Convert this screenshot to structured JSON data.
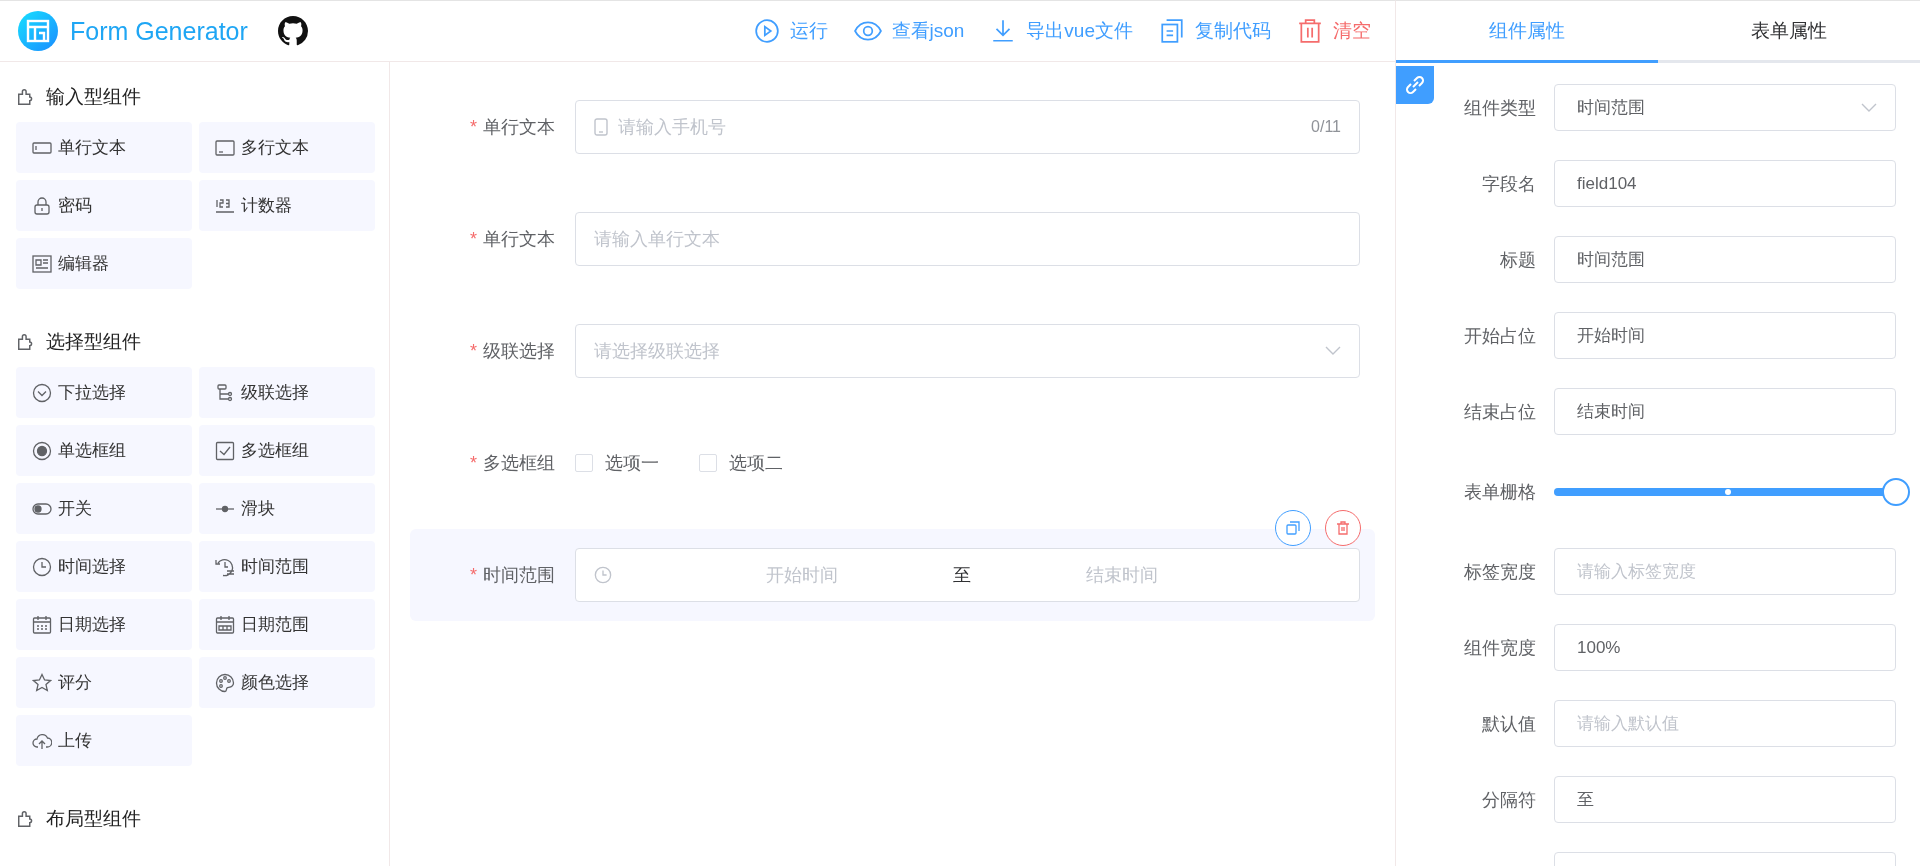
{
  "header": {
    "logo_text": "Form Generator",
    "actions": [
      {
        "label": "运行",
        "kind": "run"
      },
      {
        "label": "查看json",
        "kind": "view"
      },
      {
        "label": "导出vue文件",
        "kind": "download"
      },
      {
        "label": "复制代码",
        "kind": "copy"
      },
      {
        "label": "清空",
        "kind": "clear"
      }
    ]
  },
  "component_groups": [
    {
      "title": "输入型组件",
      "items": [
        {
          "label": "单行文本",
          "kind": "input"
        },
        {
          "label": "多行文本",
          "kind": "textarea"
        },
        {
          "label": "密码",
          "kind": "password"
        },
        {
          "label": "计数器",
          "kind": "number"
        },
        {
          "label": "编辑器",
          "kind": "editor"
        }
      ]
    },
    {
      "title": "选择型组件",
      "items": [
        {
          "label": "下拉选择",
          "kind": "select"
        },
        {
          "label": "级联选择",
          "kind": "cascader"
        },
        {
          "label": "单选框组",
          "kind": "radio"
        },
        {
          "label": "多选框组",
          "kind": "checkbox"
        },
        {
          "label": "开关",
          "kind": "switch"
        },
        {
          "label": "滑块",
          "kind": "slider"
        },
        {
          "label": "时间选择",
          "kind": "time"
        },
        {
          "label": "时间范围",
          "kind": "timerange"
        },
        {
          "label": "日期选择",
          "kind": "date"
        },
        {
          "label": "日期范围",
          "kind": "daterange"
        },
        {
          "label": "评分",
          "kind": "rate"
        },
        {
          "label": "颜色选择",
          "kind": "color"
        },
        {
          "label": "上传",
          "kind": "upload"
        }
      ]
    },
    {
      "title": "布局型组件"
    }
  ],
  "form": {
    "fields": [
      {
        "label": "单行文本",
        "required_mark": "*",
        "kind": "input",
        "prefix_icon": true,
        "placeholder": "请输入手机号",
        "counter": "0/11",
        "selected": false
      },
      {
        "label": "单行文本",
        "required_mark": "*",
        "kind": "input",
        "placeholder": "请输入单行文本",
        "selected": false
      },
      {
        "label": "级联选择",
        "required_mark": "*",
        "kind": "select",
        "placeholder": "请选择级联选择",
        "selected": false
      },
      {
        "label": "多选框组",
        "required_mark": "*",
        "kind": "checkbox",
        "options": [
          {
            "label": "选项一",
            "checked": false
          },
          {
            "label": "选项二",
            "checked": false
          }
        ],
        "selected": false
      },
      {
        "label": "时间范围",
        "required_mark": "*",
        "kind": "timerange",
        "start_placeholder": "开始时间",
        "separator": "至",
        "end_placeholder": "结束时间",
        "selected": true
      }
    ]
  },
  "panel": {
    "tabs": [
      {
        "label": "组件属性",
        "selected": true
      },
      {
        "label": "表单属性",
        "selected": false
      }
    ],
    "properties": [
      {
        "label": "组件类型",
        "kind": "select",
        "value": "时间范围"
      },
      {
        "label": "字段名",
        "kind": "input",
        "value": "field104"
      },
      {
        "label": "标题",
        "kind": "input",
        "value": "时间范围"
      },
      {
        "label": "开始占位",
        "kind": "input",
        "value": "开始时间"
      },
      {
        "label": "结束占位",
        "kind": "input",
        "value": "结束时间"
      },
      {
        "label": "表单栅格",
        "kind": "slider",
        "level": 1
      },
      {
        "label": "标签宽度",
        "kind": "input",
        "placeholder": "请输入标签宽度"
      },
      {
        "label": "组件宽度",
        "kind": "input",
        "value": "100%"
      },
      {
        "label": "默认值",
        "kind": "input",
        "placeholder": "请输入默认值"
      },
      {
        "label": "分隔符",
        "kind": "input",
        "value": "至"
      },
      {
        "kind": "input"
      }
    ]
  }
}
